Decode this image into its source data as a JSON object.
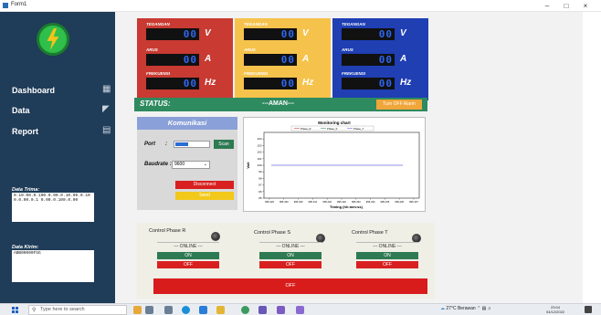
{
  "window": {
    "title": "Form1",
    "controls": {
      "minimize": "–",
      "maximize": "□",
      "close": "×"
    }
  },
  "sidebar": {
    "nav": [
      {
        "label": "Dashboard",
        "icon": "dashboard-grid-icon"
      },
      {
        "label": "Data",
        "icon": "chart-icon"
      },
      {
        "label": "Report",
        "icon": "document-icon"
      }
    ],
    "data_terima_label": "Data Trima:",
    "data_terima_value": "0.10.00.0.100.0.00.0.10.00.0.100.0.00.0.1 0.00.0.100.0.00",
    "data_kirim_label": "Data Kirim:",
    "data_kirim_value": "ABB00000FSG"
  },
  "panels": [
    {
      "color": "#c83a32",
      "rows": [
        {
          "label": "TEGANGAN",
          "value": "00",
          "unit": "V"
        },
        {
          "label": "ARUS",
          "value": "00",
          "unit": "A"
        },
        {
          "label": "FREKUENSI",
          "value": "00",
          "unit": "Hz"
        }
      ]
    },
    {
      "color": "#f5c24c",
      "rows": [
        {
          "label": "TEGANGAN",
          "value": "00",
          "unit": "V"
        },
        {
          "label": "ARUS",
          "value": "00",
          "unit": "A"
        },
        {
          "label": "FREKUENSI",
          "value": "00",
          "unit": "Hz"
        }
      ]
    },
    {
      "color": "#1f3fb3",
      "rows": [
        {
          "label": "TEGANGAN",
          "value": "00",
          "unit": "V"
        },
        {
          "label": "ARUS",
          "value": "00",
          "unit": "A"
        },
        {
          "label": "FREKUENSI",
          "value": "00",
          "unit": "Hz"
        }
      ]
    }
  ],
  "status": {
    "label": "STATUS:",
    "value": "---AMAN---",
    "alarm_button": "Turn OFF Alarm"
  },
  "komunikasi": {
    "header": "Komunikasi",
    "port_label": "Port",
    "port_sep": ":",
    "scan_button": "Scan",
    "baudrate_label": "Baudrate :",
    "baudrate_value": "9600",
    "disconnect_button": "Disconnect",
    "send_button": "Send"
  },
  "chart_data": {
    "type": "line",
    "title": "Monitoring chart",
    "xlabel": "Timing (hh:mm:ss)",
    "ylabel": "Volt",
    "legend": [
      "Phase_R",
      "Phase_S",
      "Phase_T"
    ],
    "x_ticks": [
      "995.429",
      "995.430",
      "995.430",
      "995.431",
      "995.432",
      "995.432",
      "995.433",
      "995.434",
      "995.435",
      "995.436",
      "995.437"
    ],
    "y_ticks": [
      104,
      103,
      102,
      101,
      100,
      99,
      98,
      97,
      96,
      95
    ],
    "ylim": [
      95,
      105
    ],
    "series": [
      {
        "name": "Phase_S",
        "values": [
          100,
          100
        ],
        "color": "#6a6ae0"
      }
    ]
  },
  "control": [
    {
      "label": "Control Phase R",
      "online": "--- ONLINE ---",
      "on": "ON",
      "off": "OFF"
    },
    {
      "label": "Control Phase S",
      "online": "--- ONLINE ---",
      "on": "ON",
      "off": "OFF"
    },
    {
      "label": "Control Phase T",
      "online": "--- ONLINE ---",
      "on": "ON",
      "off": "OFF"
    }
  ],
  "all_off_button": "OFF",
  "taskbar": {
    "search_placeholder": "Type here to search",
    "weather": "27°C Berawan",
    "time": "23:04",
    "date": "04/12/2022"
  }
}
